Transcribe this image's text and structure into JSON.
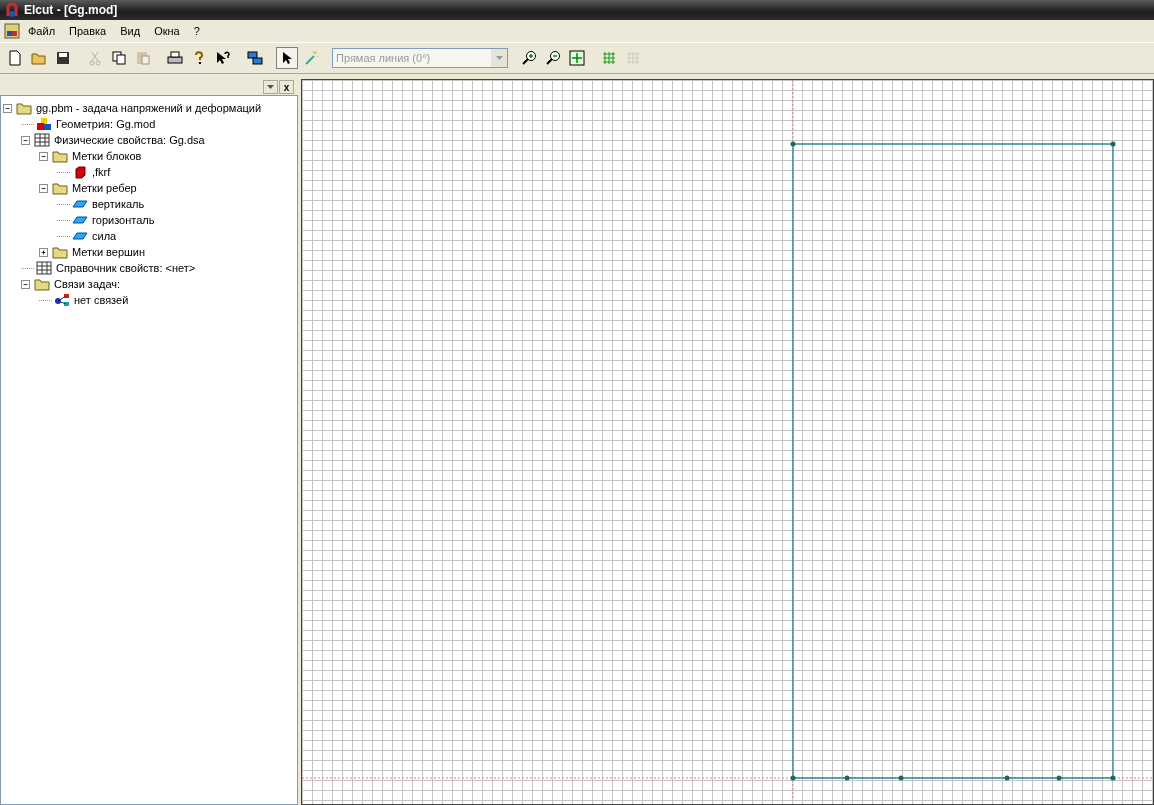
{
  "window": {
    "title": "Elcut - [Gg.mod]"
  },
  "menu": [
    "Файл",
    "Правка",
    "Вид",
    "Окна",
    "?"
  ],
  "toolbar": {
    "groups": [
      [
        {
          "kind": "new",
          "disabled": false,
          "pressed": false
        },
        {
          "kind": "open",
          "disabled": false,
          "pressed": false
        },
        {
          "kind": "save",
          "disabled": false,
          "pressed": false
        }
      ],
      [
        {
          "kind": "cut",
          "disabled": true,
          "pressed": false
        },
        {
          "kind": "copy",
          "disabled": false,
          "pressed": false
        },
        {
          "kind": "paste",
          "disabled": true,
          "pressed": false
        }
      ],
      [
        {
          "kind": "print",
          "disabled": false,
          "pressed": false
        },
        {
          "kind": "help",
          "disabled": false,
          "pressed": false
        },
        {
          "kind": "context-help",
          "disabled": false,
          "pressed": false
        }
      ],
      [
        {
          "kind": "windows",
          "disabled": false,
          "pressed": false
        }
      ],
      [
        {
          "kind": "select",
          "disabled": false,
          "pressed": true
        },
        {
          "kind": "wand",
          "disabled": false,
          "pressed": false
        }
      ],
      [
        {
          "kind": "combo",
          "value": "Прямая линия (0°)",
          "disabled": true
        }
      ],
      [
        {
          "kind": "zoom-in",
          "disabled": false,
          "pressed": false
        },
        {
          "kind": "zoom-out",
          "disabled": false,
          "pressed": false
        },
        {
          "kind": "fit",
          "disabled": false,
          "pressed": false
        }
      ],
      [
        {
          "kind": "mesh",
          "disabled": false,
          "pressed": false
        },
        {
          "kind": "mesh-remove",
          "disabled": true,
          "pressed": false
        }
      ]
    ]
  },
  "panel": {
    "close_button": "x"
  },
  "tree": [
    {
      "label": "gg.pbm -  задача напряжений и деформаций",
      "kind": "folder",
      "expanded": true,
      "children": [
        {
          "label": "Геометрия: Gg.mod",
          "kind": "geometry"
        },
        {
          "label": "Физические свойства: Gg.dsa",
          "kind": "table",
          "expanded": true,
          "children": [
            {
              "label": "Метки блоков",
              "kind": "folder",
              "expanded": true,
              "children": [
                {
                  "label": ",fkrf",
                  "kind": "block"
                }
              ]
            },
            {
              "label": "Метки ребер",
              "kind": "folder",
              "expanded": true,
              "children": [
                {
                  "label": "вертикаль",
                  "kind": "edge"
                },
                {
                  "label": "горизонталь",
                  "kind": "edge"
                },
                {
                  "label": "сила",
                  "kind": "edge"
                }
              ]
            },
            {
              "label": "Метки вершин",
              "kind": "folder",
              "expanded": false
            }
          ]
        },
        {
          "label": "Справочник свойств: <нет>",
          "kind": "table"
        },
        {
          "label": "Связи задач:",
          "kind": "folder",
          "expanded": true,
          "children": [
            {
              "label": "нет связей",
              "kind": "links"
            }
          ]
        }
      ]
    }
  ]
}
